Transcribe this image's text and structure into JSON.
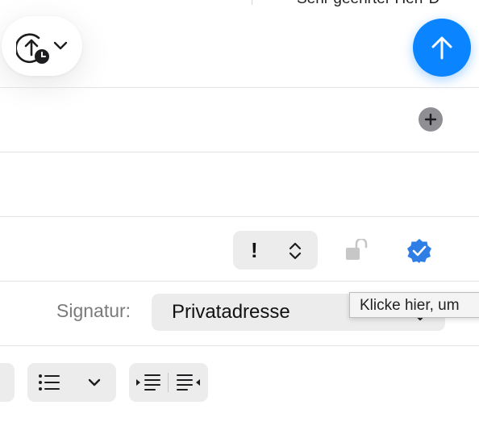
{
  "background": {
    "partial_text": "Sehr geehrter Herr D"
  },
  "toolbar": {
    "send_later_icon": "clock-send-icon",
    "chevron_icon": "chevron-down-icon",
    "send_icon": "arrow-up-icon",
    "accent_color": "#0a84ff"
  },
  "cc_row": {
    "add_icon": "plus-circle-icon"
  },
  "options_row": {
    "priority_value": "!",
    "priority_stepper_icon": "up-down-chevron-icon",
    "lock_icon": "unlocked-padlock-icon",
    "verify_icon": "verified-badge-icon"
  },
  "tooltip": {
    "text": "Klicke hier, um"
  },
  "signature": {
    "label": "Signatur:",
    "value": "Privatadresse"
  },
  "format_bar": {
    "list_icon": "bulleted-list-icon",
    "indent_decrease_icon": "decrease-indent-icon",
    "indent_increase_icon": "increase-indent-icon"
  }
}
